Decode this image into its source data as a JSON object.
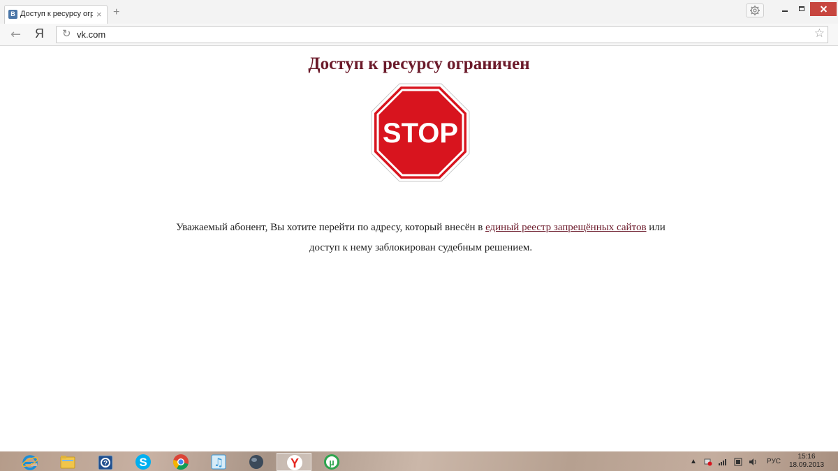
{
  "browser": {
    "tab": {
      "favicon": "В",
      "title": "Доступ к ресурсу огр",
      "close": "×"
    },
    "new_tab": "+",
    "back": "←",
    "yandex_button": "Я",
    "reload": "↻",
    "address": "vk.com",
    "bookmark": "☆"
  },
  "page": {
    "title": "Доступ к ресурсу ограничен",
    "stop_sign_text": "STOP",
    "notice_before_link": "Уважаемый абонент, Вы хотите перейти по адресу, который внесён в ",
    "notice_link": "единый реестр запрещённых сайтов",
    "notice_after_link": " или доступ к нему заблокирован судебным решением."
  },
  "taskbar": {
    "apps": [
      {
        "icon": "internet-explorer-icon",
        "color": "#1a8fd8"
      },
      {
        "icon": "file-explorer-icon",
        "color": "#f1c54b"
      },
      {
        "icon": "help-icon",
        "color": "#1f4f8f"
      },
      {
        "icon": "skype-icon",
        "color": "#00aff0"
      },
      {
        "icon": "chrome-icon",
        "color": "#db4437"
      },
      {
        "icon": "music-player-icon",
        "color": "#3a9ad9"
      },
      {
        "icon": "globe-icon",
        "color": "#3b4a5a"
      },
      {
        "icon": "yandex-browser-icon",
        "color": "#e52620"
      },
      {
        "icon": "utorrent-icon",
        "color": "#2ea44f"
      }
    ],
    "tray": {
      "language": "РУС"
    },
    "clock": {
      "time": "15:16",
      "date": "18.09.2013"
    }
  },
  "colors": {
    "title": "#6b1a2a",
    "stop_red": "#d8141e",
    "close_button": "#c7463f"
  }
}
